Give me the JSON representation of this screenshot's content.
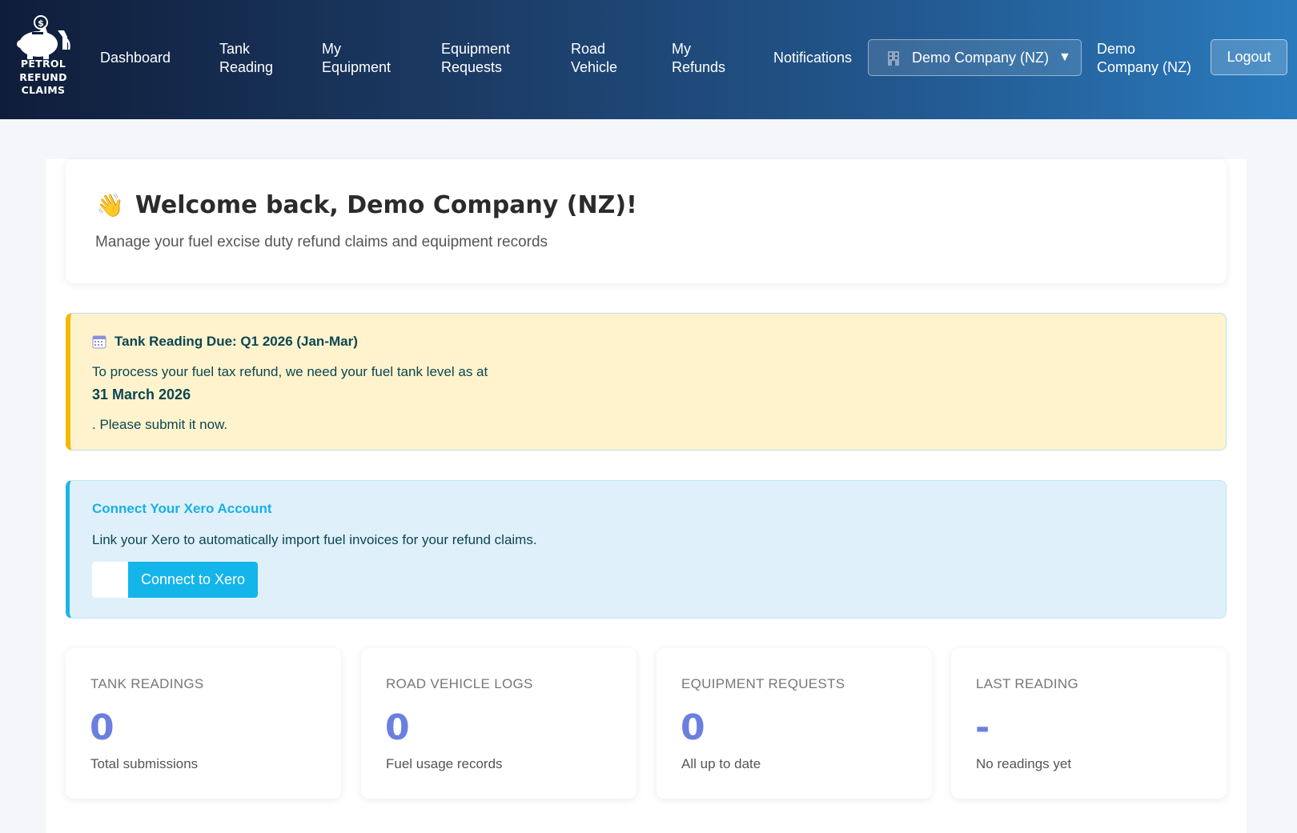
{
  "brand": {
    "logo_lines": [
      "PETROL",
      "REFUND",
      "CLAIMS"
    ]
  },
  "nav": {
    "items": [
      {
        "lines": [
          "Dashboard"
        ]
      },
      {
        "lines": [
          "Tank",
          "Reading"
        ]
      },
      {
        "lines": [
          "My",
          "Equipment"
        ]
      },
      {
        "lines": [
          "Equipment",
          "Requests"
        ]
      },
      {
        "lines": [
          "Road",
          "Vehicle"
        ]
      },
      {
        "lines": [
          "My",
          "Refunds"
        ]
      },
      {
        "lines": [
          "Notifications"
        ]
      }
    ],
    "company_selector": "Demo Company (NZ)",
    "user_name_lines": [
      "Demo",
      "Company (NZ)"
    ],
    "logout_label": "Logout"
  },
  "welcome": {
    "title": "Welcome back, Demo Company (NZ)!",
    "subtitle": "Manage your fuel excise duty refund claims and equipment records"
  },
  "tank_alert": {
    "title": "Tank Reading Due: Q1 2026 (Jan-Mar)",
    "line1": "To process your fuel tax refund, we need your fuel tank level as at",
    "date": "31 March 2026",
    "line2": ". Please submit it now."
  },
  "xero": {
    "title": "Connect Your Xero Account",
    "description": "Link your Xero to automatically import fuel invoices for your refund claims.",
    "button_label": "Connect to Xero"
  },
  "stats": [
    {
      "label": "TANK READINGS",
      "value": "0",
      "sub": "Total submissions"
    },
    {
      "label": "ROAD VEHICLE LOGS",
      "value": "0",
      "sub": "Fuel usage records"
    },
    {
      "label": "EQUIPMENT REQUESTS",
      "value": "0",
      "sub": "All up to date"
    },
    {
      "label": "LAST READING",
      "value": "-",
      "sub": "No readings yet"
    }
  ],
  "colors": {
    "accent_value": "#6a7fe0",
    "warning_border": "#f5b800",
    "info_border": "#1fb3e0",
    "xero_button": "#13b5ea"
  }
}
